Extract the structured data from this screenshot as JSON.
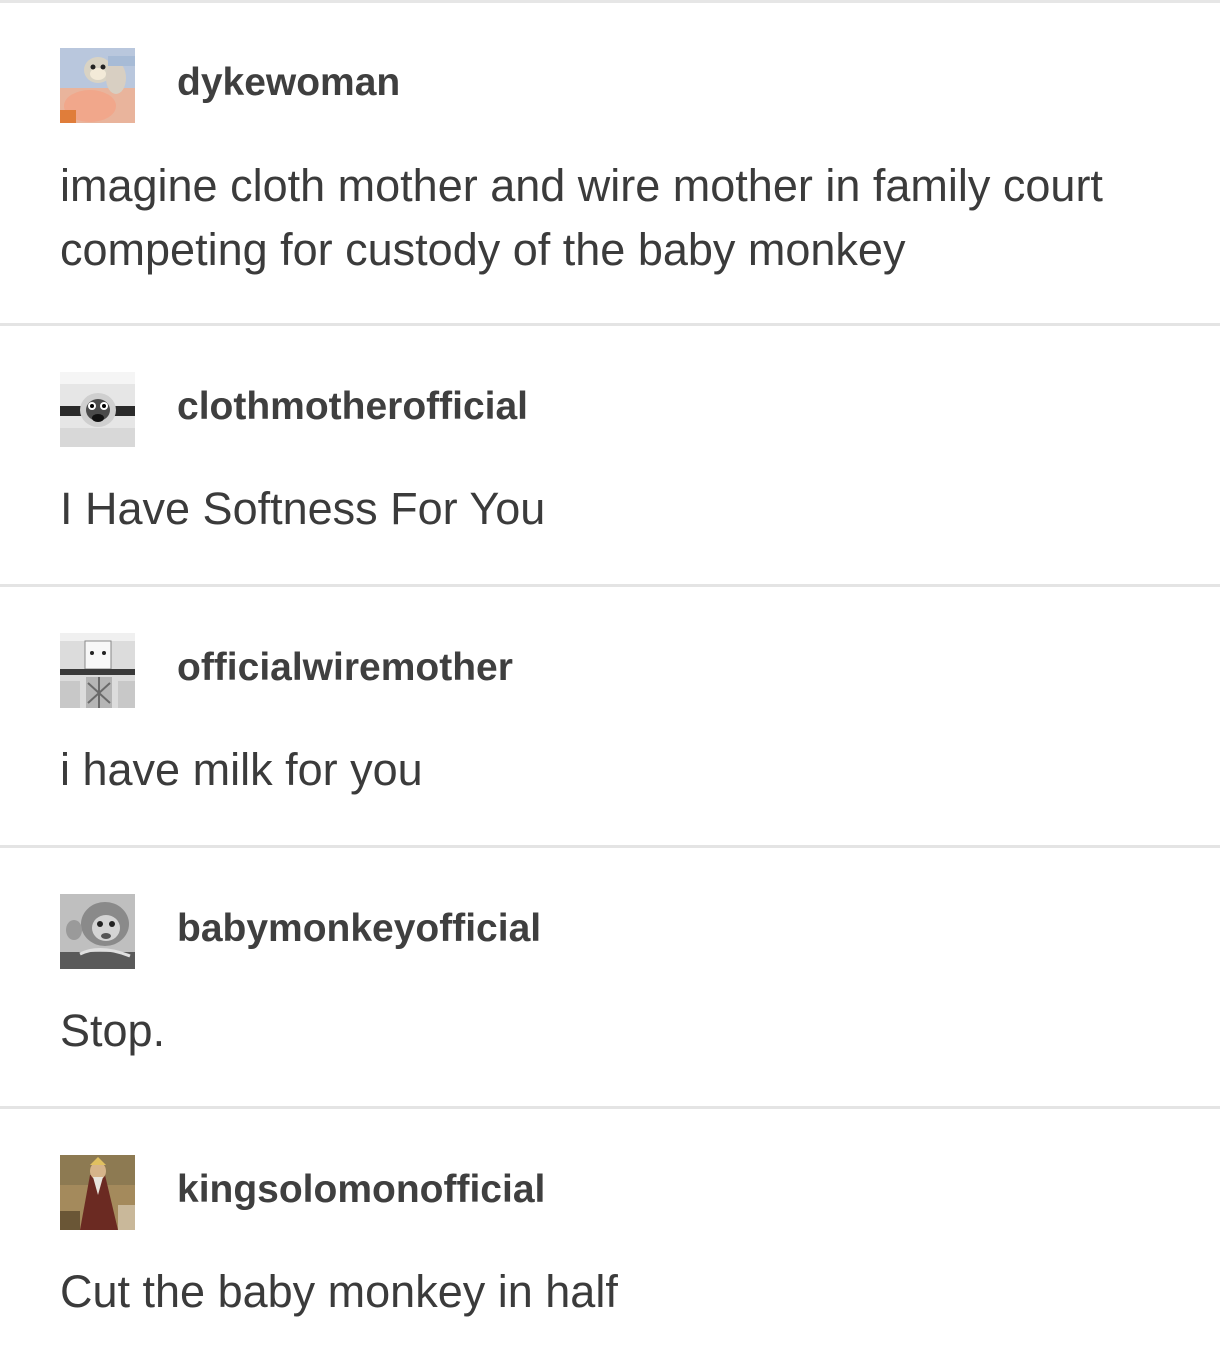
{
  "posts": [
    {
      "username": "dykewoman",
      "text": "imagine cloth mother and wire mother in family court competing for custody of the baby monkey",
      "avatar_icon": "plush-monkey-avatar"
    },
    {
      "username": "clothmotherofficial",
      "text": "I Have Softness For You",
      "avatar_icon": "cloth-mother-avatar"
    },
    {
      "username": "officialwiremother",
      "text": "i have milk for you",
      "avatar_icon": "wire-mother-avatar"
    },
    {
      "username": "babymonkeyofficial",
      "text": "Stop.",
      "avatar_icon": "baby-monkey-avatar"
    },
    {
      "username": "kingsolomonofficial",
      "text": "Cut the baby monkey in half",
      "avatar_icon": "king-solomon-avatar"
    }
  ],
  "colors": {
    "divider": "#e4e4e4",
    "text": "#3b3b3b",
    "background": "#ffffff"
  }
}
